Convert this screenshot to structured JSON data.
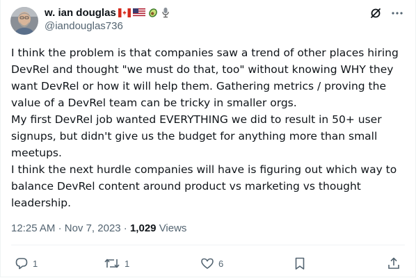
{
  "author": {
    "display_name": "w. ian douglas",
    "handle": "@iandouglas736",
    "badge_icons": [
      "canada-flag-icon",
      "us-flag-icon",
      "avocado-icon",
      "microphone-icon"
    ]
  },
  "tweet": {
    "paragraphs": [
      "I think the problem is that companies saw a trend of other places hiring DevRel and thought \"we must do that, too\" without knowing WHY they want DevRel or how it will help them. Gathering metrics / proving the value of a DevRel team can be tricky in smaller orgs.",
      "My first DevRel job wanted EVERYTHING we did to result in 50+ user signups, but didn't give us the budget for anything more than small meetups.",
      "I think the next hurdle companies will have is figuring out which way to balance DevRel content around product vs marketing vs thought leadership."
    ],
    "time": "12:25 AM",
    "separator": "·",
    "date": "Nov 7, 2023",
    "views_count": "1,029",
    "views_label": "Views"
  },
  "actions": {
    "replies": "1",
    "reposts": "1",
    "likes": "6"
  },
  "colors": {
    "text": "#0f1419",
    "secondary": "#536471",
    "divider": "#eff3f4"
  }
}
